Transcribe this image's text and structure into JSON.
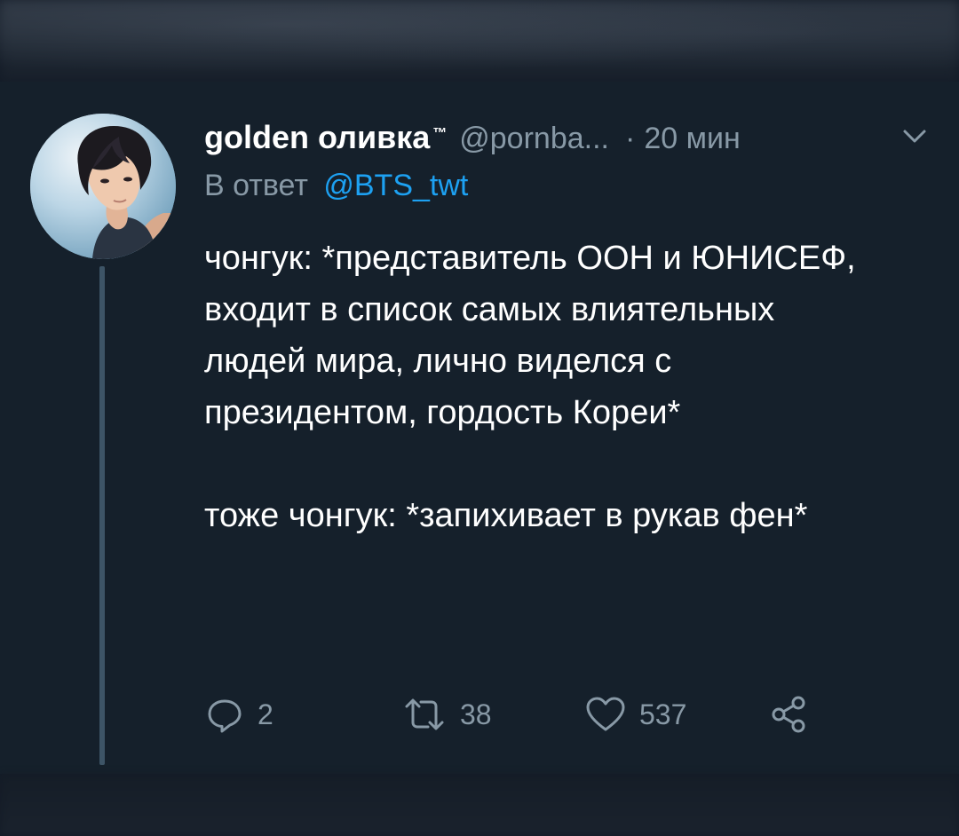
{
  "tweet": {
    "display_name": "golden оливка",
    "trademark": "™",
    "handle": "@pornba...",
    "separator": "·",
    "time": "20 мин",
    "reply_prefix": "В ответ",
    "reply_handle": "@BTS_twt",
    "text": [
      "чонгук: *представитель ООН и ЮНИСЕФ, входит в список самых влиятельных людей мира, лично виделся с президентом, гордость Кореи*",
      "тоже чонгук: *запихивает в рукав фен*"
    ]
  },
  "actions": {
    "reply_count": "2",
    "retweet_count": "38",
    "like_count": "537"
  },
  "icons": {
    "reply": "reply-icon",
    "retweet": "retweet-icon",
    "like": "heart-icon",
    "share": "share-icon",
    "caret": "chevron-down-icon"
  },
  "colors": {
    "background": "#15202b",
    "text": "#ffffff",
    "muted": "#8899a6",
    "link": "#1da1f2",
    "thread_line": "#3d5466"
  }
}
